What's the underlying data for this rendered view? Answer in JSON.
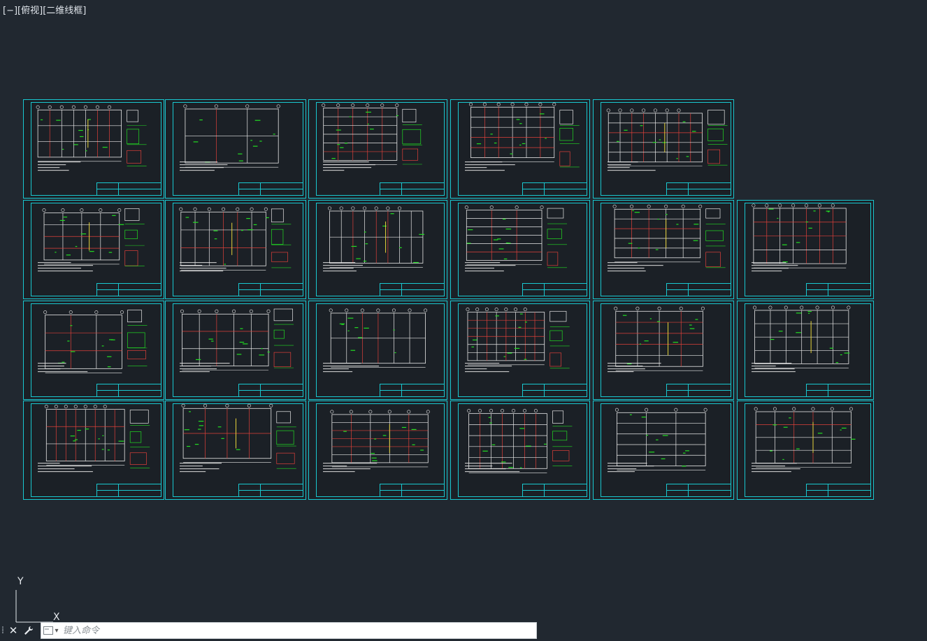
{
  "viewport": {
    "controls_label": "[−]",
    "view_label": "[俯视]",
    "visual_style_label": "[二维线框]"
  },
  "ucs": {
    "y_label": "Y",
    "x_label": "X"
  },
  "command_line": {
    "placeholder": "键入命令",
    "close_icon": "close-icon",
    "customize_icon": "wrench-icon",
    "prompt_icon": "command-prompt-icon"
  },
  "colors": {
    "background": "#212830",
    "sheet_border": "#19c8d0",
    "line_white": "#e8e8e8",
    "line_green": "#22dd22",
    "line_red": "#e0403a",
    "line_yellow": "#e6d23a"
  },
  "sheets": {
    "rows": [
      {
        "row": 1,
        "count": 5
      },
      {
        "row": 2,
        "count": 6
      },
      {
        "row": 3,
        "count": 6
      },
      {
        "row": 4,
        "count": 6
      }
    ]
  }
}
